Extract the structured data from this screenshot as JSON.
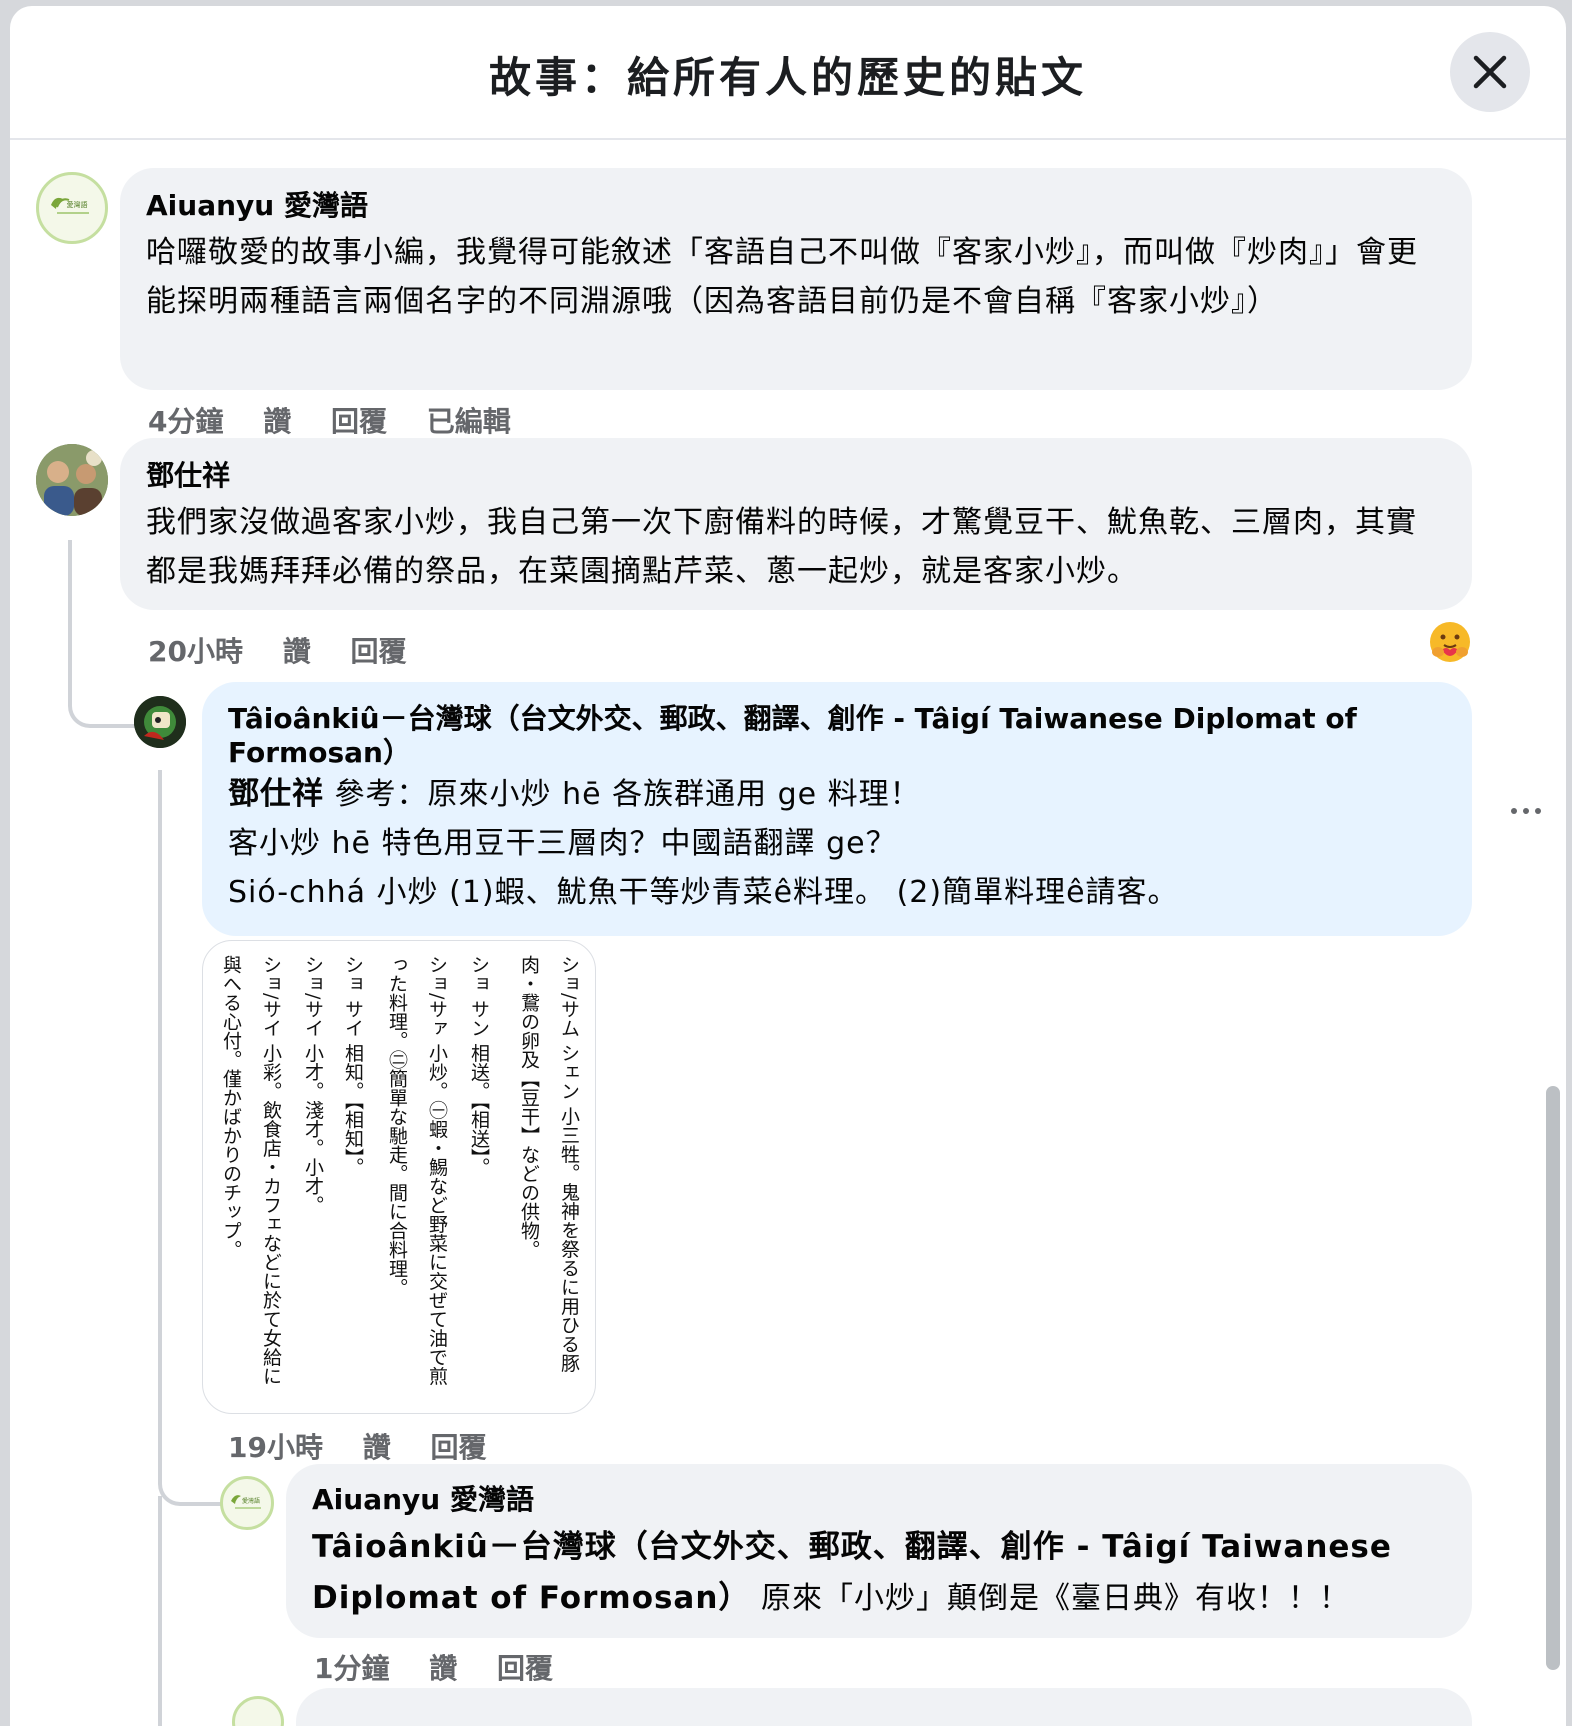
{
  "header": {
    "title": "故事：給所有人的歷史的貼文"
  },
  "comments": [
    {
      "author": "Aiuanyu 愛灣語",
      "avatar_text": "愛灣語",
      "text": "哈囉敬愛的故事小編，我覺得可能敘述「客語自己不叫做『客家小炒』，而叫做『炒肉』」會更能探明兩種語言兩個名字的不同淵源哦（因為客語目前仍是不會自稱『客家小炒』）",
      "time": "4分鐘",
      "like": "讚",
      "reply": "回覆",
      "edited": "已編輯"
    },
    {
      "author": "鄧仕祥",
      "text": "我們家沒做過客家小炒，我自己第一次下廚備料的時候，才驚覺豆干、魷魚乾、三層肉，其實都是我媽拜拜必備的祭品，在菜園摘點芹菜、蔥一起炒，就是客家小炒。",
      "time": "20小時",
      "like": "讚",
      "reply": "回覆",
      "reaction": "care-emoji"
    }
  ],
  "replies": [
    {
      "author": "Tâioânkiû－台灣球（台文外交、郵政、翻譯、創作 - Tâigí Taiwanese Diplomat of Formosan）",
      "mention": "鄧仕祥",
      "line1": " 參考：原來小炒 hē 各族群通用 ge 料理！",
      "line2": "客小炒 hē 特色用豆干三層肉？中國語翻譯 ge？",
      "line3": "Sió-chhá 小炒 (1)蝦、魷魚干等炒青菜ê料理。 (2)簡單料理ê請客。",
      "time": "19小時",
      "like": "讚",
      "reply": "回覆",
      "more": "···",
      "dictionary_image": {
        "columns": [
          "ショ/サム シェン 小三牲。鬼神を祭るに用ひる豚肉・鵞の卵及【豆干】などの供物。",
          "ショ サン 相送。【相送】。",
          "ショ/サァ 小炒。㊀蝦・鯣など野菜に交ぜて油で煎った料理。㊁簡單な馳走。間に合料理。",
          "ショ サイ 相知。【相知】。",
          "ショ/サイ 小才。淺才。小才。",
          "ショ/サイ 小彩。飲食店・カフェなどに於て女給に與へる心付。僅かばかりのチップ。"
        ]
      }
    },
    {
      "author": "Aiuanyu 愛灣語",
      "avatar_text": "愛灣語",
      "mention": "Tâioânkiû－台灣球（台文外交、郵政、翻譯、創作 - Tâigí Taiwanese Diplomat of Formosan）",
      "text": " 原來「小炒」顛倒是《臺日典》有收！！！",
      "time": "1分鐘",
      "like": "讚",
      "reply": "回覆"
    }
  ],
  "colors": {
    "bubble": "#f0f2f5",
    "bubble_highlight": "#e7f3ff",
    "meta_text": "#65676b",
    "avatar_green": "#7aa63a"
  }
}
